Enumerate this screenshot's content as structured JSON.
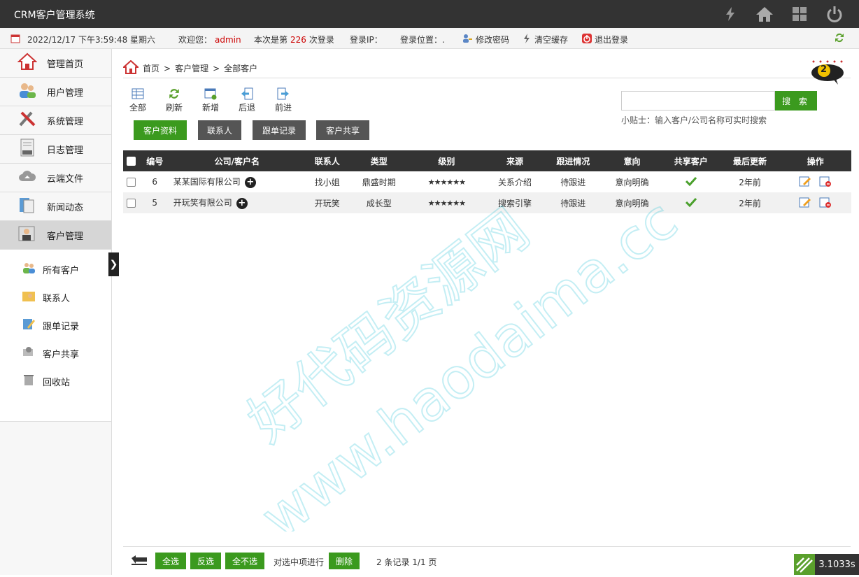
{
  "header": {
    "title": "CRM客户管理系统"
  },
  "info": {
    "datetime": "2022/12/17 下午3:59:48 星期六",
    "welcome_label": "欢迎您：",
    "user": "admin",
    "login_prefix": "本次是第",
    "login_count": "226",
    "login_suffix": "次登录",
    "ip_label": "登录IP：",
    "location_label": "登录位置：.",
    "change_pwd": "修改密码",
    "clear_cache": "清空缓存",
    "logout": "退出登录"
  },
  "sidebar": {
    "items": [
      "管理首页",
      "用户管理",
      "系统管理",
      "日志管理",
      "云端文件",
      "新闻动态",
      "客户管理"
    ],
    "sub_items": [
      "所有客户",
      "联系人",
      "跟单记录",
      "客户共享",
      "回收站"
    ]
  },
  "breadcrumb": {
    "home": "首页",
    "sep1": ">",
    "section": "客户管理",
    "sep2": ">",
    "page": "全部客户"
  },
  "badge": {
    "count": "2"
  },
  "toolbar": {
    "all": "全部",
    "refresh": "刷新",
    "add": "新增",
    "back": "后退",
    "forward": "前进"
  },
  "tabs": [
    "客户资料",
    "联系人",
    "跟单记录",
    "客户共享"
  ],
  "search": {
    "button": "搜 索",
    "tip": "小贴士：输入客户/公司名称可实时搜索"
  },
  "table": {
    "headers": [
      "编号",
      "公司/客户名",
      "联系人",
      "类型",
      "级别",
      "来源",
      "跟进情况",
      "意向",
      "共享客户",
      "最后更新",
      "操作"
    ],
    "rows": [
      {
        "id": "6",
        "company": "某某国际有限公司",
        "contact": "找小姐",
        "type": "鼎盛时期",
        "level": "★★★★★★",
        "source": "关系介绍",
        "follow": "待跟进",
        "intent": "意向明确",
        "updated": "2年前"
      },
      {
        "id": "5",
        "company": "开玩笑有限公司",
        "contact": "开玩笑",
        "type": "成长型",
        "level": "★★★★★★",
        "source": "搜索引擎",
        "follow": "待跟进",
        "intent": "意向明确",
        "updated": "2年前"
      }
    ]
  },
  "footer": {
    "select_all": "全选",
    "invert": "反选",
    "select_none": "全不选",
    "batch_label": "对选中项进行",
    "delete": "删除",
    "records": "2 条记录 1/1 页",
    "timer": "3.1033s"
  },
  "watermark": {
    "line1": "好代码资源网",
    "line2": "www.haodaima.cc"
  }
}
